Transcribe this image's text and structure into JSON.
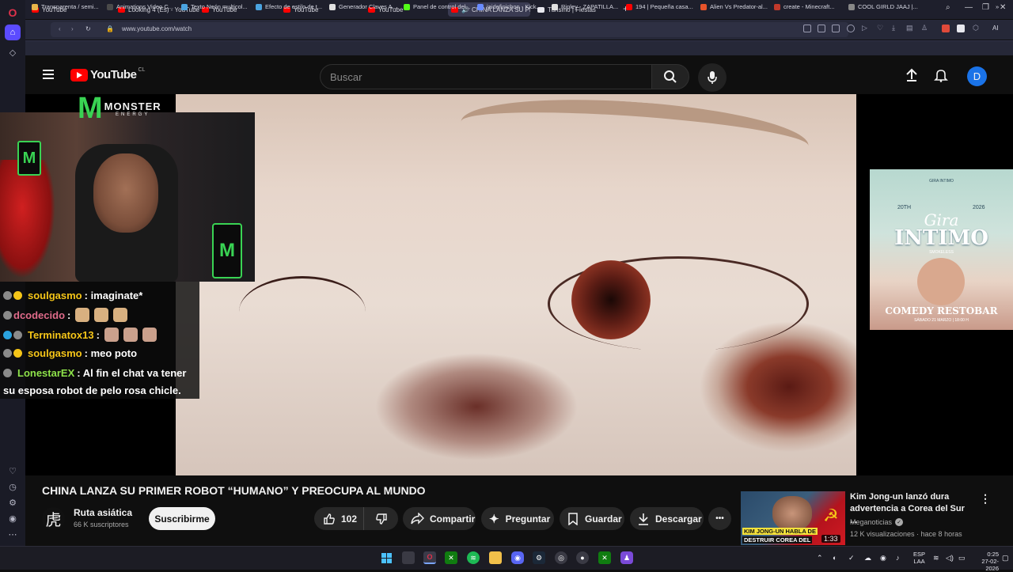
{
  "browser": {
    "tabs": [
      {
        "label": "YouTube",
        "active": false
      },
      {
        "label": "Looking 4 (Es) - YouTube",
        "active": false
      },
      {
        "label": "YouTube",
        "active": false
      },
      {
        "label": "YouTube",
        "active": false
      },
      {
        "label": "YouTube",
        "active": false
      },
      {
        "label": "CHINA LANZA SU PR...",
        "active": true
      },
      {
        "label": "Turismo | Fiestas",
        "active": false
      }
    ],
    "new_tab_label": "+",
    "url": "www.youtube.com/watch",
    "ai_label": "AI",
    "bookmarks": [
      {
        "label": "Transparenta / semi...",
        "color": "#e8b54a"
      },
      {
        "label": "Animations Video C...",
        "color": "#4a4a4a"
      },
      {
        "label": "Texto Neón multicol...",
        "color": "#4aa3e0"
      },
      {
        "label": "Efecto de estilo de t...",
        "color": "#4aa3e0"
      },
      {
        "label": "Generador Claves A...",
        "color": "#e0e0e0"
      },
      {
        "label": "Panel de control del...",
        "color": "#53fc18"
      },
      {
        "label": "jaidefinichon - Kick...",
        "color": "#6a8cff"
      },
      {
        "label": "Ripley - ZAPATILLA...",
        "color": "#e0e0e0"
      },
      {
        "label": "194 | Pequeña casa...",
        "color": "#ff0000"
      },
      {
        "label": "Alien Vs Predator-al...",
        "color": "#e8532a"
      },
      {
        "label": "create - Minecraft...",
        "color": "#c0392b"
      },
      {
        "label": "COOL GIRLD JAAJ |...",
        "color": "#888888"
      }
    ]
  },
  "youtube": {
    "logo_text": "YouTube",
    "region": "CL",
    "search_placeholder": "Buscar",
    "avatar_letter": "D"
  },
  "video": {
    "title": "CHINA LANZA SU PRIMER ROBOT “HUMANO” Y PREOCUPA AL MUNDO",
    "channel": {
      "name": "Ruta asiática",
      "subscribers": "66 K suscriptores",
      "avatar_glyph": "虎"
    },
    "subscribe_label": "Suscribirme",
    "likes": "102",
    "share_label": "Compartir",
    "ask_label": "Preguntar",
    "save_label": "Guardar",
    "download_label": "Descargar",
    "more_label": "•••"
  },
  "overlay": {
    "brand": "MONSTER",
    "brand_sub": "ENERGY",
    "chat": [
      {
        "user": "soulgasmo",
        "message": ": imaginate*",
        "color": "#f5c518",
        "badge": "#f5c518"
      },
      {
        "user": "dcodecido",
        "message": ":",
        "color": "#e06b8a",
        "badge": "#8a8a8a",
        "emotes": 3
      },
      {
        "user": "Terminatox13",
        "message": ":",
        "color": "#f5c518",
        "badge": "#2aa3e0",
        "emotes": 3
      },
      {
        "user": "soulgasmo",
        "message": ": meo poto",
        "color": "#f5c518",
        "badge": "#f5c518"
      },
      {
        "user": "LonestarEX",
        "message": ": Al fin el chat va tener",
        "color": "#8ee24a",
        "badge": "#8a8a8a"
      }
    ],
    "chat_continuation": "su esposa robot de pelo rosa chicle."
  },
  "ad_poster": {
    "top_line": "GIRA INTIMO",
    "title": "INTIMO",
    "script_title": "Gira",
    "group": "SMOKELESS",
    "venue": "COMEDY RESTOBAR",
    "date": "SÁBADO 21 MARZO | 18:00 H",
    "years_left": "20TH",
    "years_right": "2026"
  },
  "recommendation": {
    "title": "Kim Jong-un lanzó dura advertencia a Corea del Sur ...",
    "channel": "Meganoticias",
    "meta": "12 K visualizaciones · hace 8 horas",
    "duration": "1:33",
    "thumb_caption_1": "KIM JONG-UN HABLA DE",
    "thumb_caption_2": "DESTRUIR COREA DEL"
  },
  "taskbar": {
    "language": "ESP",
    "layout": "LAA",
    "time": "0:25",
    "date": "27-02-2026"
  },
  "colors": {
    "accent_red": "#ff0000",
    "avatar_blue": "#1a73e8",
    "active_tab": "#3a3b52"
  }
}
